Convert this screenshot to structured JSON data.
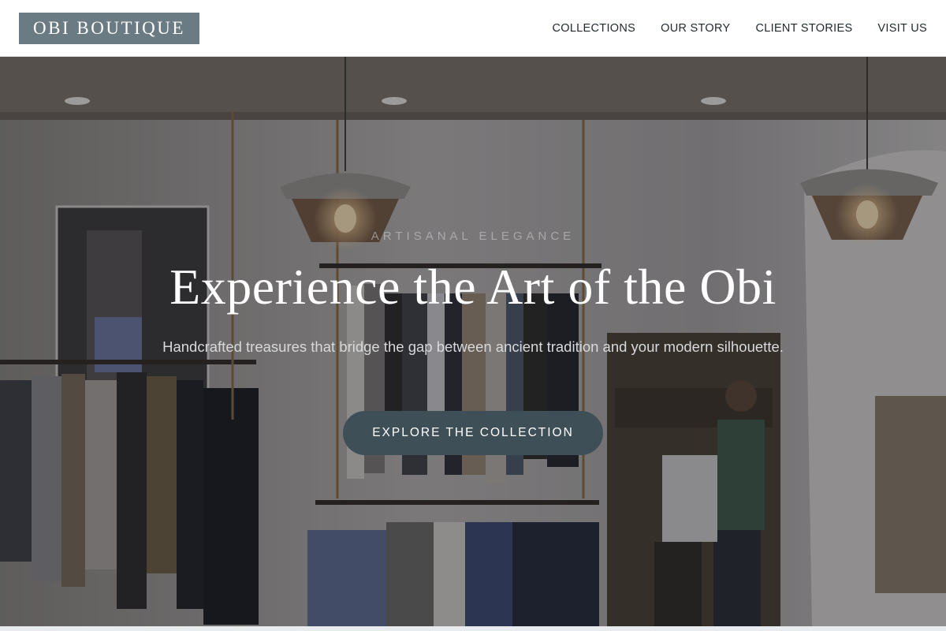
{
  "header": {
    "logo": "OBI BOUTIQUE",
    "nav": [
      {
        "label": "COLLECTIONS"
      },
      {
        "label": "OUR STORY"
      },
      {
        "label": "CLIENT STORIES"
      },
      {
        "label": "VISIT US"
      }
    ]
  },
  "hero": {
    "eyebrow": "ARTISANAL ELEGANCE",
    "title": "Experience the Art of the Obi",
    "subtitle": "Handcrafted treasures that bridge the gap between ancient tradition and your modern silhouette.",
    "cta_label": "EXPLORE THE COLLECTION"
  },
  "colors": {
    "logo_bg": "#6b7b84",
    "cta_bg": "#3f4f57",
    "nav_text": "#222a2e"
  }
}
